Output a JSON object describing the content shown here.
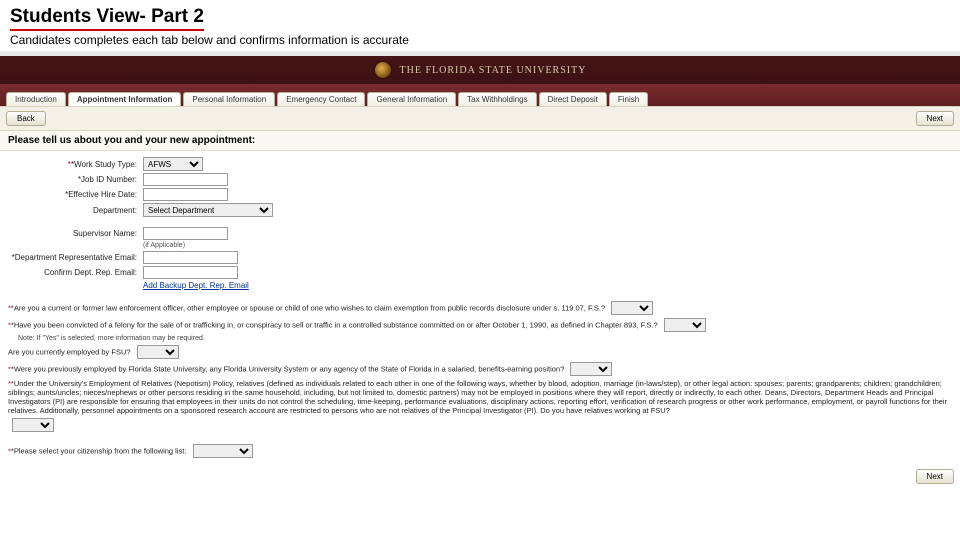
{
  "slide": {
    "title": "Students View- Part 2",
    "subtitle": "Candidates completes each tab below and confirms information is accurate"
  },
  "banner": {
    "name": "THE FLORIDA STATE UNIVERSITY"
  },
  "tabs": [
    "Introduction",
    "Appointment Information",
    "Personal Information",
    "Emergency Contact",
    "General Information",
    "Tax Withholdings",
    "Direct Deposit",
    "Finish"
  ],
  "active_tab": 1,
  "nav": {
    "back": "Back",
    "next": "Next"
  },
  "section_title": "Please tell us about you and your new appointment:",
  "form": {
    "work_study_label": "*Work Study Type:",
    "work_study_value": "AFWS",
    "job_id_label": "*Job ID Number:",
    "eff_date_label": "*Effective Hire Date:",
    "dept_label": "Department:",
    "dept_placeholder": "Select Department",
    "sup_label": "Supervisor Name:",
    "sup_note": "(if Applicable)",
    "dept_rep_label": "*Department Representative Email:",
    "confirm_rep_label": "Confirm Dept. Rep. Email:",
    "add_backup": "Add Backup Dept. Rep. Email"
  },
  "questions": {
    "q1": "*Are you a current or former law enforcement officer, other employee or spouse or child of one who wishes to claim exemption from public records disclosure under s. 119.07, F.S.?",
    "q2": "*Have you been convicted of a felony for the sale of or trafficking in, or conspiracy to sell or traffic in a controlled substance committed on or after October 1, 1990, as defined in Chapter 893, F.S.?",
    "q2_sub": "Note: If \"Yes\" is selected, more information may be required.",
    "q3": "Are you currently employed by FSU?",
    "q4": "*Were you previously employed by Florida State University, any Florida University System or any agency of the State of Florida in a salaried, benefits-earning position?",
    "q5": "*Under the University's Employment of Relatives (Nepotism) Policy, relatives (defined as individuals related to each other in one of the following ways, whether by blood, adoption, marriage (in-laws/step), or other legal action: spouses; parents; grandparents; children; grandchildren; siblings; aunts/uncles; nieces/nephews or other persons residing in the same household, including, but not limited to, domestic partners) may not be employed in positions where they will report, directly or indirectly, to each other. Deans, Directors, Department Heads and Principal Investigators (PI) are responsible for ensuring that employees in their units do not control the scheduling, time-keeping, performance evaluations, disciplinary actions, reporting effort, verification of research progress or other work performance, employment, or payroll functions for their relatives. Additionally, personnel appointments on a sponsored research account are restricted to persons who are not relatives of the Principal Investigator (PI). Do you have relatives working at FSU?",
    "q6": "*Please select your citizenship from the following list:"
  }
}
